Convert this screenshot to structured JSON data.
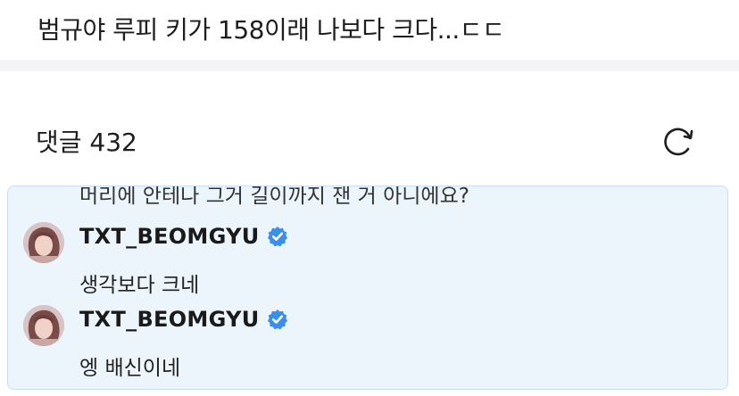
{
  "post": {
    "title": "범규야 루피 키가 158이래 나보다 크다...ㄷㄷ"
  },
  "comments_section": {
    "header": "댓글 432",
    "refresh_icon": "refresh-icon"
  },
  "thread": {
    "partial_text": "머리에 안테나 그거 길이까지 잰 거 아니에요?",
    "replies": [
      {
        "author": "TXT_BEOMGYU",
        "verified": true,
        "text": "생각보다 크네"
      },
      {
        "author": "TXT_BEOMGYU",
        "verified": true,
        "text": "엥 배신이네"
      }
    ]
  },
  "colors": {
    "thread_background": "#edf5fc",
    "thread_border": "#c9def2",
    "verified_badge": "#3a8fe8"
  }
}
